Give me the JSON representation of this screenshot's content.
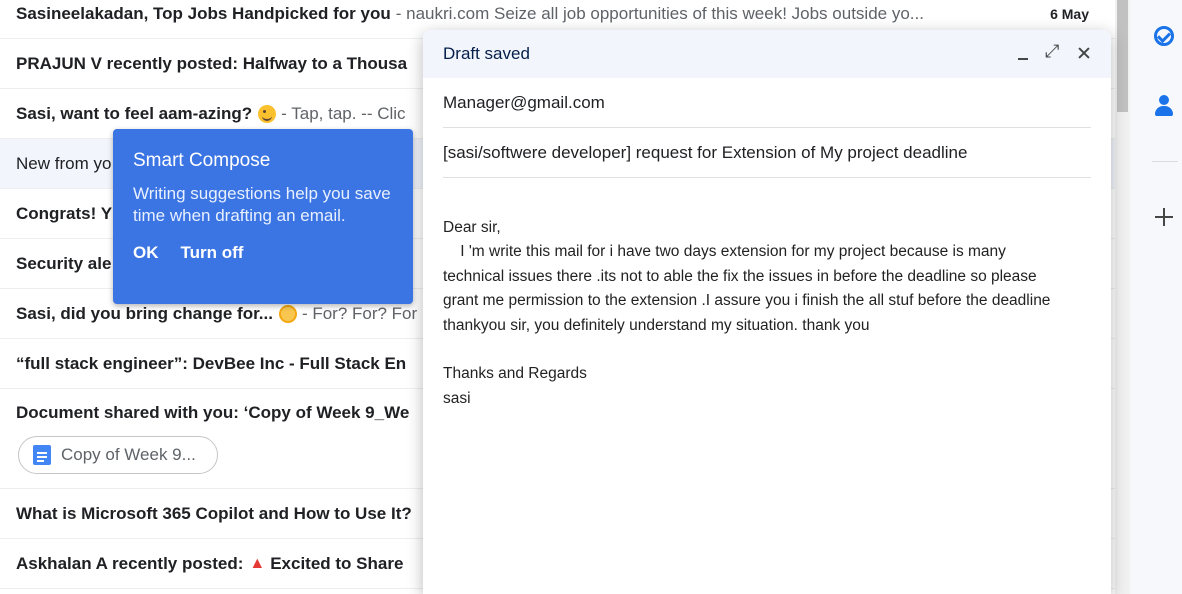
{
  "inbox": {
    "rows": [
      {
        "subject": "Sasineelakadan, Top Jobs Handpicked for you",
        "snippet": "- naukri.com Seize all job opportunities of this week! Jobs outside yo...",
        "date": "6 May"
      },
      {
        "subject": "PRAJUN V recently posted: Halfway to a Thousa",
        "snippet": ""
      },
      {
        "subject": "Sasi, want to feel aam-azing?",
        "snippet": "- Tap, tap. -- Clic"
      },
      {
        "subject": "New from yo",
        "snippet": ""
      },
      {
        "subject": "Congrats! Y",
        "snippet": ""
      },
      {
        "subject": "Security ale",
        "snippet": ""
      },
      {
        "subject": "Sasi, did you bring change for...",
        "snippet": "- For? For? For"
      },
      {
        "subject": "“full stack engineer”: DevBee Inc - Full Stack En",
        "snippet": ""
      },
      {
        "subject": "Document shared with you: ‘Copy of Week 9_We",
        "snippet": ""
      },
      {
        "subject": "What is Microsoft 365 Copilot and How to Use It?",
        "snippet": ""
      },
      {
        "subject": "Askhalan A recently posted:",
        "snippet": "Excited to Share"
      }
    ],
    "attachment_chip": "Copy of Week 9..."
  },
  "smart_compose": {
    "title": "Smart Compose",
    "body": "Writing suggestions help you save time when drafting an email.",
    "ok": "OK",
    "turn_off": "Turn off"
  },
  "compose": {
    "title": "Draft saved",
    "to": "Manager@gmail.com",
    "subject": "[sasi/softwere developer] request for Extension of My project deadline",
    "body": "Dear sir,\n    I 'm write this mail for i have two days extension for my project because is many\ntechnical issues there .its not to able the fix the issues in before the deadline so please\ngrant me permission to the extension .I assure you i finish the all stuf before the deadline\nthankyou sir, you definitely understand my situation. thank you\n\nThanks and Regards\nsasi"
  },
  "colors": {
    "tooltip_bg": "#3b74e3",
    "compose_header_bg": "#f2f6fc",
    "accent": "#1a73e8"
  },
  "icons": [
    "tasks-icon",
    "contacts-icon",
    "plus-icon",
    "minimize-icon",
    "expand-icon",
    "close-icon",
    "docs-icon",
    "wink-emoji",
    "coin-emoji",
    "rocket-emoji"
  ]
}
